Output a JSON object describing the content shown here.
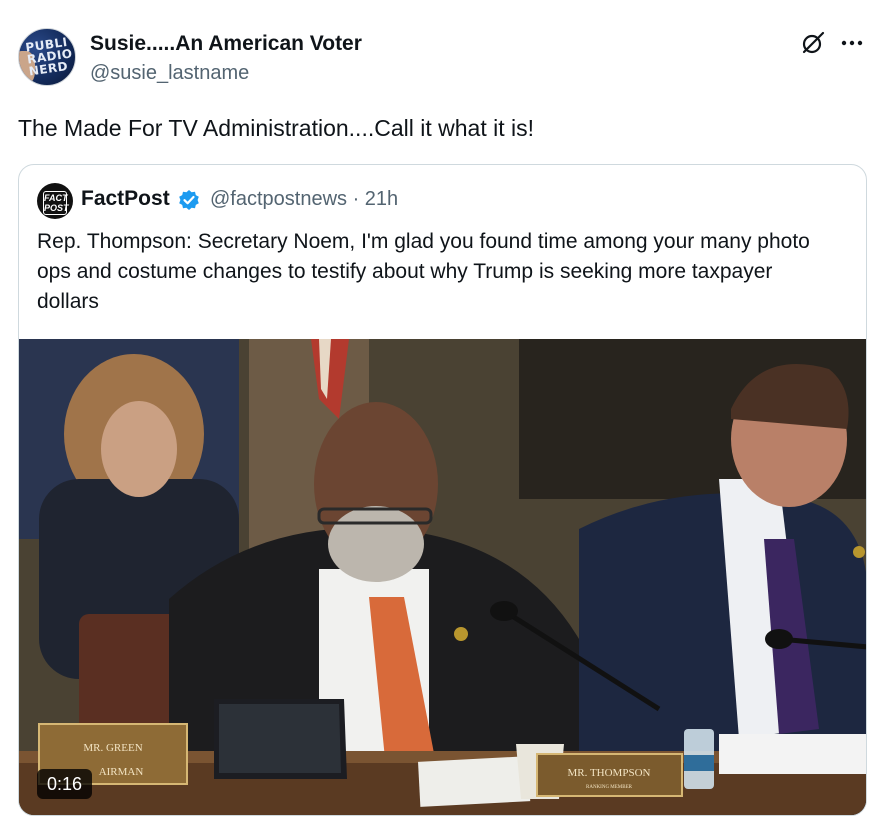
{
  "post": {
    "author_name": "Susie.....An American Voter",
    "author_handle": "@susie_lastname",
    "avatar_text": [
      "PUBLI",
      "RADIO",
      "NERD"
    ],
    "text": "The Made For TV Administration....Call it what it is!"
  },
  "quoted_post": {
    "avatar_text": [
      "FACT",
      "POST"
    ],
    "author_name": "FactPost",
    "verified": true,
    "author_handle": "@factpostnews · 21h",
    "text": "Rep. Thompson: Secretary Noem, I'm glad you found time among your many photo ops and costume changes to testify about why Trump is seeking more taxpayer dollars",
    "media": {
      "type": "video",
      "duration": "0:16",
      "nameplate_left_line1": "MR. GREEN",
      "nameplate_left_line2": "AIRMAN",
      "nameplate_center_line1": "MR. THOMPSON",
      "nameplate_center_line2": "RANKING MEMBER"
    }
  },
  "icons": {
    "grok": "grok-icon",
    "more": "more-options-icon",
    "verified": "verified-badge-icon"
  },
  "colors": {
    "text_primary": "#0f1419",
    "text_secondary": "#536471",
    "border": "#cfd9de",
    "verified_blue": "#1d9bf0"
  }
}
